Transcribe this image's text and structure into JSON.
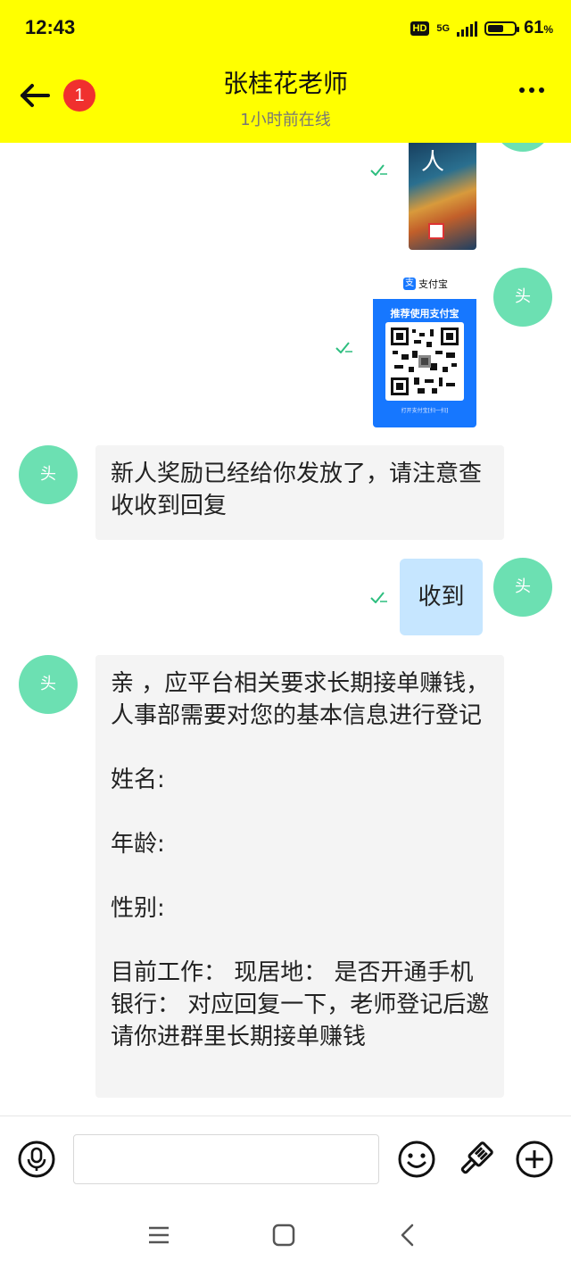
{
  "status_bar": {
    "time": "12:43",
    "hd": "HD",
    "network": "5G",
    "battery_level": 0.61,
    "battery_number": "61",
    "battery_unit": "%"
  },
  "header": {
    "unread_count": "1",
    "title": "张桂花老师",
    "subtitle": "1小时前在线",
    "back_icon": "arrow-left",
    "more_icon": "three-dots"
  },
  "colors": {
    "header_bg": "#FFFF00",
    "avatar": "#6CE0B2",
    "incoming_bubble": "#F4F4F4",
    "outgoing_bubble": "#C6E6FF",
    "badge": "#F0302E",
    "read_check": "#2DBE7F",
    "alipay_blue": "#1677FF"
  },
  "messages": {
    "alipay_brand": "支付宝",
    "alipay_brand_icon": "支",
    "alipay_recommend": "推荐使用支付宝",
    "alipay_hint": "打开支付宝[扫一扫]",
    "reward_text": "新人奖励已经给你发放了，请注意查收收到回复",
    "reply_text": "收到",
    "register_text": "亲 ，应平台相关要求长期接单赚钱，人事部需要对您的基本信息进行登记\n\n姓名:\n\n年龄:\n\n性别:\n\n目前工作： 现居地： 是否开通手机银行： 对应回复一下，老师登记后邀请你进群里长期接单赚钱",
    "avatar_glyph": "头"
  },
  "input_bar": {
    "placeholder": "",
    "icons": [
      "microphone-icon",
      "emoji-icon",
      "brush-icon",
      "plus-icon"
    ]
  },
  "nav_bar": {
    "icons": [
      "menu-icon",
      "home-icon",
      "back-icon"
    ]
  }
}
